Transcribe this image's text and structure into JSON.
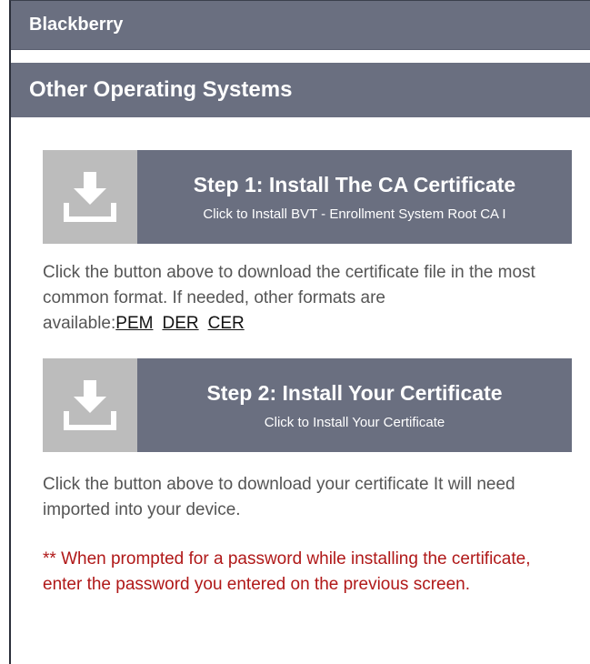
{
  "bb_header": {
    "title": "Blackberry"
  },
  "os_header": {
    "title": "Other Operating Systems"
  },
  "step1": {
    "title": "Step 1: Install The CA Certificate",
    "subtitle": "Click to Install BVT - Enrollment System Root CA I",
    "icon": "download-icon"
  },
  "step1_desc": {
    "text": "Click the button above to download the certificate file in the most common format. If needed, other formats are available:",
    "formats": [
      "PEM",
      "DER",
      "CER"
    ]
  },
  "step2": {
    "title": "Step 2: Install Your Certificate",
    "subtitle": "Click to Install Your Certificate",
    "icon": "download-icon"
  },
  "step2_desc": {
    "text": "Click the button above to download your certificate It will need imported into your device."
  },
  "warning": {
    "text": "** When prompted for a password while installing the certificate, enter the password you entered on the previous screen.",
    "color": "#b01818"
  },
  "colors": {
    "header_bg": "#6a6f80",
    "icon_bg": "#bcbcbc",
    "text": "#555555"
  }
}
